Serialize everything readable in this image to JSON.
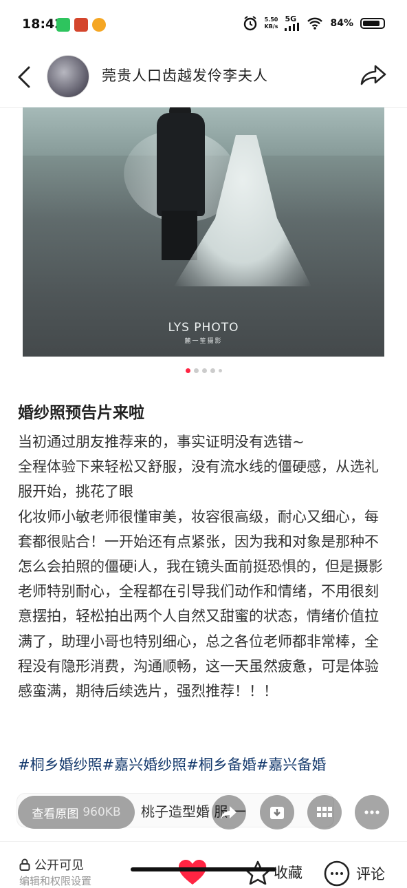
{
  "status_bar": {
    "time": "18:42",
    "network_speed": "5.50",
    "network_unit": "KB/s",
    "network_type": "5G",
    "battery_percent": "84%",
    "battery_level": 0.84
  },
  "header": {
    "author_name": "莞贵人口齿越发伶李夫人"
  },
  "photo": {
    "watermark_main": "LYS PHOTO",
    "watermark_sub": "麓一笙摄影",
    "page_count": 5,
    "current_page": 1
  },
  "post": {
    "title": "婚纱照预告片来啦",
    "paragraphs": [
      "当初通过朋友推荐来的，事实证明没有选错~",
      "全程体验下来轻松又舒服，没有流水线的僵硬感，从选礼服开始，挑花了眼",
      "化妆师小敏老师很懂审美，妆容很高级，耐心又细心，每套都很贴合！一开始还有点紧张，因为我和对象是那种不怎么会拍照的僵硬i人，我在镜头面前挺恐惧的，但是摄影老师特别耐心，全程都在引导我们动作和情绪，不用很刻意摆拍，轻松拍出两个人自然又甜蜜的状态，情绪价值拉满了，助理小哥也特别细心，总之各位老师都非常棒，全程没有隐形消费，沟通顺畅，这一天虽然疲惫，可是体验感蛮满，期待后续选片，强烈推荐！！！"
    ],
    "tags": [
      "#桐乡婚纱照",
      "#嘉兴婚纱照",
      "#桐乡备婚",
      "#嘉兴备婚"
    ]
  },
  "related": {
    "text": "桃子造型婚 服 一"
  },
  "image_actions": {
    "view_original_label": "查看原图",
    "view_original_size": "960KB",
    "share_icon": "share-icon",
    "download_icon": "download-icon",
    "grid_icon": "grid-icon",
    "more_icon": "more-icon"
  },
  "footer": {
    "visibility_label": "公开可见",
    "visibility_sub": "编辑和权限设置",
    "collect_label": "收藏",
    "comment_label": "评论",
    "like_color": "#ff2442"
  }
}
